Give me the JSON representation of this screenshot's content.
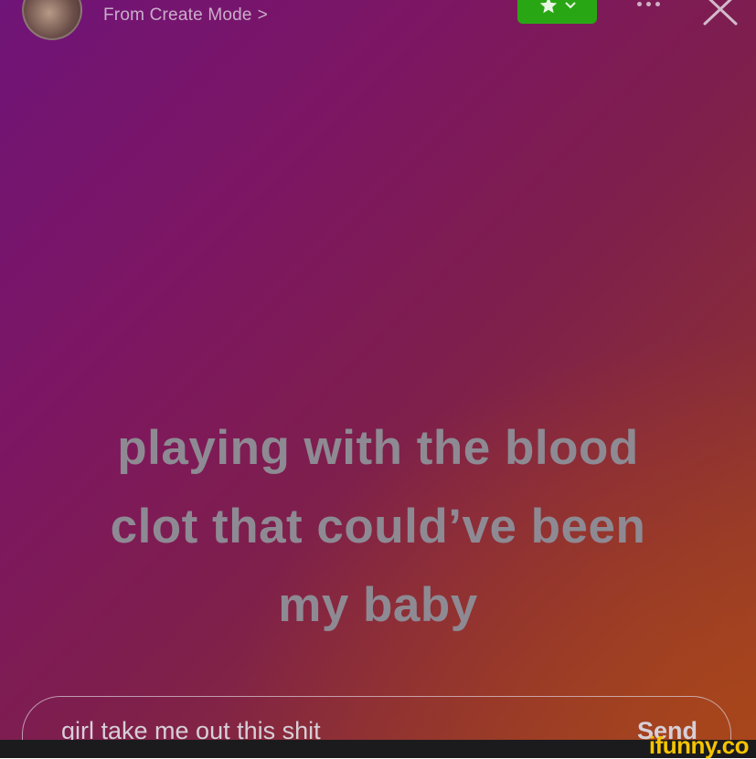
{
  "header": {
    "source_label": "From Create Mode",
    "source_chevron": ">",
    "avatar_icon": "user-avatar",
    "sticker_icon": "star-icon",
    "sticker_color": "#29a614",
    "more_icon": "more-dots-icon",
    "close_icon": "close-icon"
  },
  "story": {
    "caption_lines": [
      "playing with the blood",
      "clot that could’ve been",
      "my baby"
    ],
    "background_colors": [
      "#6f1478",
      "#7e1f4c",
      "#9a4225"
    ],
    "caption_color": "#8e8a93"
  },
  "reply": {
    "text": "girl take me out this shit",
    "send_label": "Send"
  },
  "watermark": {
    "text": "ifunny.co",
    "color": "#f6c400"
  }
}
